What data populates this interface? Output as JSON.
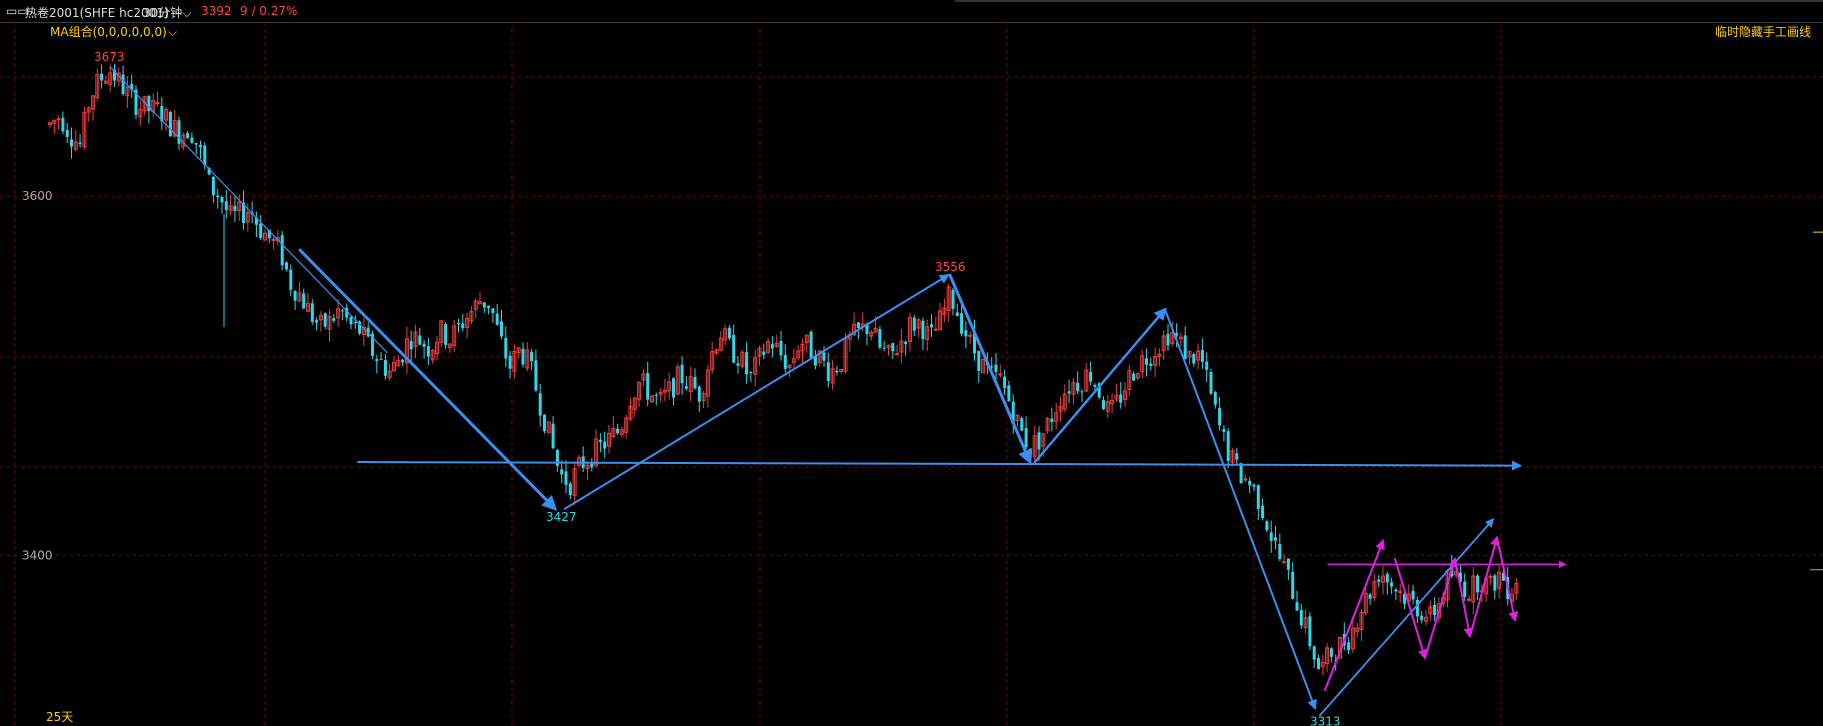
{
  "header": {
    "window_icon": "window-restore-icon",
    "symbol_label": "热卷2001(SHFE hc2001)",
    "period_label": "30分钟",
    "period_icon": "chevron-down-icon",
    "price": "3392",
    "change": "9 / 0.27%"
  },
  "overlay": {
    "indicator_label": "MA组合(0,0,0,0,0,0)",
    "indicator_icon": "chevron-down-icon",
    "hide_drawing_label": "临时隐藏手工画线",
    "days_label": "25天"
  },
  "colors": {
    "background": "#000000",
    "grid": "#8a0000",
    "up": "#e84040",
    "down": "#33d6e6",
    "trend_blue": "#3b8ff0",
    "trend_magenta": "#e020e0",
    "label_red": "#ff4444",
    "label_cyan": "#33d6e6",
    "label_yellow": "#ffd000"
  },
  "chart_data": {
    "type": "candlestick",
    "ylim": [
      3305,
      3697
    ],
    "y_ticks": [
      3400,
      3600
    ],
    "grid": true,
    "annotations": [
      {
        "text": "3673",
        "x": 94,
        "y": 3673,
        "color": "label_red"
      },
      {
        "text": "3427",
        "x": 546,
        "y": 3427,
        "color": "label_cyan"
      },
      {
        "text": "3556",
        "x": 935,
        "y": 3556,
        "color": "label_red"
      },
      {
        "text": "3313",
        "x": 1310,
        "y": 3313,
        "color": "label_cyan"
      }
    ],
    "trend_lines": [
      {
        "x1": 110,
        "y1": 3672,
        "x2": 387,
        "y2": 3513,
        "color": "trend_blue",
        "arrow": false,
        "width": 1.2
      },
      {
        "x1": 300,
        "y1": 3570,
        "x2": 555,
        "y2": 3426,
        "color": "trend_blue",
        "arrow": true,
        "width": 3
      },
      {
        "x1": 565,
        "y1": 3426,
        "x2": 948,
        "y2": 3556,
        "color": "trend_blue",
        "arrow": true,
        "width": 2
      },
      {
        "x1": 950,
        "y1": 3556,
        "x2": 1030,
        "y2": 3452,
        "color": "trend_blue",
        "arrow": true,
        "width": 3
      },
      {
        "x1": 1035,
        "y1": 3452,
        "x2": 1165,
        "y2": 3537,
        "color": "trend_blue",
        "arrow": true,
        "width": 2.5
      },
      {
        "x1": 358,
        "y1": 3452,
        "x2": 1520,
        "y2": 3450,
        "color": "trend_blue",
        "arrow": true,
        "width": 2
      },
      {
        "x1": 1165,
        "y1": 3537,
        "x2": 1315,
        "y2": 3315,
        "color": "trend_blue",
        "arrow": true,
        "width": 2
      },
      {
        "x1": 1320,
        "y1": 3311,
        "x2": 1493,
        "y2": 3420,
        "color": "trend_blue",
        "arrow": true,
        "width": 1.8
      },
      {
        "x1": 1325,
        "y1": 3325,
        "x2": 1383,
        "y2": 3408,
        "color": "trend_magenta",
        "arrow": true,
        "width": 2
      },
      {
        "x1": 1395,
        "y1": 3398,
        "x2": 1425,
        "y2": 3343,
        "color": "trend_magenta",
        "arrow": true,
        "width": 2
      },
      {
        "x1": 1425,
        "y1": 3343,
        "x2": 1455,
        "y2": 3398,
        "color": "trend_magenta",
        "arrow": true,
        "width": 2
      },
      {
        "x1": 1455,
        "y1": 3398,
        "x2": 1470,
        "y2": 3355,
        "color": "trend_magenta",
        "arrow": true,
        "width": 2
      },
      {
        "x1": 1470,
        "y1": 3355,
        "x2": 1497,
        "y2": 3410,
        "color": "trend_magenta",
        "arrow": true,
        "width": 2
      },
      {
        "x1": 1497,
        "y1": 3410,
        "x2": 1515,
        "y2": 3364,
        "color": "trend_magenta",
        "arrow": true,
        "width": 2
      },
      {
        "x1": 1328,
        "y1": 3395,
        "x2": 1565,
        "y2": 3395,
        "color": "trend_magenta",
        "arrow": true,
        "width": 1.5
      }
    ],
    "path_points": [
      [
        50,
        3640
      ],
      [
        60,
        3645
      ],
      [
        70,
        3635
      ],
      [
        80,
        3628
      ],
      [
        90,
        3655
      ],
      [
        100,
        3665
      ],
      [
        110,
        3670
      ],
      [
        120,
        3663
      ],
      [
        130,
        3655
      ],
      [
        140,
        3650
      ],
      [
        150,
        3648
      ],
      [
        160,
        3648
      ],
      [
        170,
        3640
      ],
      [
        180,
        3635
      ],
      [
        190,
        3638
      ],
      [
        200,
        3625
      ],
      [
        210,
        3605
      ],
      [
        220,
        3600
      ],
      [
        230,
        3588
      ],
      [
        240,
        3590
      ],
      [
        250,
        3593
      ],
      [
        260,
        3582
      ],
      [
        270,
        3576
      ],
      [
        280,
        3570
      ],
      [
        290,
        3552
      ],
      [
        300,
        3545
      ],
      [
        310,
        3535
      ],
      [
        320,
        3527
      ],
      [
        330,
        3530
      ],
      [
        340,
        3537
      ],
      [
        350,
        3528
      ],
      [
        360,
        3525
      ],
      [
        370,
        3515
      ],
      [
        380,
        3508
      ],
      [
        390,
        3502
      ],
      [
        400,
        3510
      ],
      [
        410,
        3522
      ],
      [
        420,
        3520
      ],
      [
        430,
        3515
      ],
      [
        440,
        3525
      ],
      [
        450,
        3520
      ],
      [
        460,
        3528
      ],
      [
        470,
        3535
      ],
      [
        480,
        3542
      ],
      [
        490,
        3540
      ],
      [
        500,
        3520
      ],
      [
        510,
        3505
      ],
      [
        520,
        3515
      ],
      [
        530,
        3505
      ],
      [
        540,
        3485
      ],
      [
        550,
        3465
      ],
      [
        560,
        3445
      ],
      [
        570,
        3440
      ],
      [
        580,
        3450
      ],
      [
        590,
        3455
      ],
      [
        600,
        3460
      ],
      [
        610,
        3465
      ],
      [
        620,
        3470
      ],
      [
        630,
        3488
      ],
      [
        640,
        3497
      ],
      [
        650,
        3490
      ],
      [
        660,
        3485
      ],
      [
        670,
        3492
      ],
      [
        680,
        3500
      ],
      [
        690,
        3495
      ],
      [
        700,
        3490
      ],
      [
        710,
        3510
      ],
      [
        720,
        3525
      ],
      [
        730,
        3515
      ],
      [
        740,
        3510
      ],
      [
        750,
        3498
      ],
      [
        760,
        3510
      ],
      [
        770,
        3520
      ],
      [
        780,
        3512
      ],
      [
        790,
        3505
      ],
      [
        800,
        3520
      ],
      [
        810,
        3515
      ],
      [
        820,
        3510
      ],
      [
        830,
        3502
      ],
      [
        840,
        3507
      ],
      [
        850,
        3520
      ],
      [
        860,
        3525
      ],
      [
        870,
        3528
      ],
      [
        880,
        3515
      ],
      [
        890,
        3510
      ],
      [
        900,
        3518
      ],
      [
        910,
        3528
      ],
      [
        920,
        3530
      ],
      [
        930,
        3520
      ],
      [
        940,
        3530
      ],
      [
        950,
        3545
      ],
      [
        960,
        3532
      ],
      [
        970,
        3518
      ],
      [
        980,
        3508
      ],
      [
        990,
        3500
      ],
      [
        1000,
        3498
      ],
      [
        1010,
        3485
      ],
      [
        1020,
        3470
      ],
      [
        1030,
        3460
      ],
      [
        1040,
        3465
      ],
      [
        1050,
        3475
      ],
      [
        1060,
        3488
      ],
      [
        1070,
        3495
      ],
      [
        1080,
        3497
      ],
      [
        1090,
        3502
      ],
      [
        1100,
        3490
      ],
      [
        1110,
        3478
      ],
      [
        1120,
        3488
      ],
      [
        1130,
        3500
      ],
      [
        1140,
        3508
      ],
      [
        1150,
        3512
      ],
      [
        1160,
        3518
      ],
      [
        1170,
        3525
      ],
      [
        1180,
        3518
      ],
      [
        1190,
        3510
      ],
      [
        1200,
        3512
      ],
      [
        1210,
        3490
      ],
      [
        1220,
        3470
      ],
      [
        1230,
        3455
      ],
      [
        1240,
        3445
      ],
      [
        1250,
        3440
      ],
      [
        1260,
        3430
      ],
      [
        1270,
        3413
      ],
      [
        1280,
        3398
      ],
      [
        1290,
        3385
      ],
      [
        1300,
        3368
      ],
      [
        1310,
        3352
      ],
      [
        1320,
        3335
      ],
      [
        1330,
        3345
      ],
      [
        1340,
        3350
      ],
      [
        1350,
        3355
      ],
      [
        1360,
        3370
      ],
      [
        1370,
        3380
      ],
      [
        1380,
        3392
      ],
      [
        1390,
        3385
      ],
      [
        1400,
        3380
      ],
      [
        1410,
        3375
      ],
      [
        1420,
        3370
      ],
      [
        1430,
        3365
      ],
      [
        1440,
        3375
      ],
      [
        1450,
        3390
      ],
      [
        1460,
        3385
      ],
      [
        1470,
        3380
      ],
      [
        1480,
        3388
      ],
      [
        1490,
        3382
      ],
      [
        1500,
        3390
      ],
      [
        1510,
        3380
      ],
      [
        1520,
        3392
      ]
    ]
  }
}
